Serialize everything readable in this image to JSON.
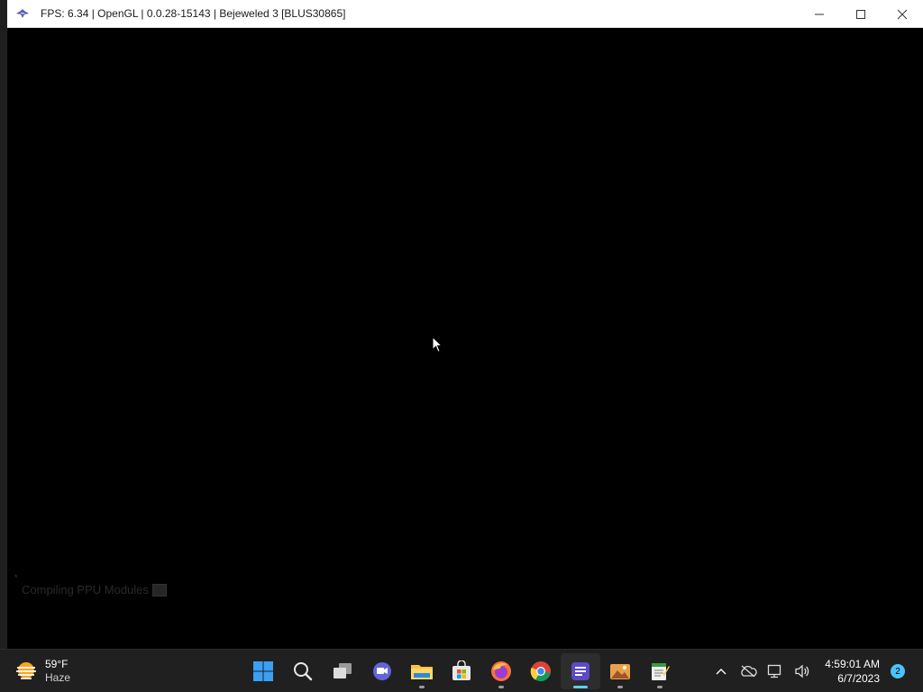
{
  "window": {
    "title": "FPS: 6.34 | OpenGL | 0.0.28-15143 | Bejeweled 3 [BLUS30865]",
    "app_icon": "rpcs3-icon",
    "controls": {
      "minimize_icon": "minimize-icon",
      "maximize_icon": "maximize-icon",
      "close_icon": "close-icon"
    }
  },
  "viewport": {
    "status_mark": "*",
    "compile_message": "Compiling PPU Modules"
  },
  "taskbar": {
    "weather": {
      "temp": "59°F",
      "condition": "Haze",
      "icon": "haze-weather-icon"
    },
    "apps": [
      {
        "name": "start-button",
        "icon": "windows-start-icon"
      },
      {
        "name": "search-button",
        "icon": "search-icon"
      },
      {
        "name": "task-view-button",
        "icon": "task-view-icon"
      },
      {
        "name": "teams-chat-button",
        "icon": "teams-chat-icon"
      },
      {
        "name": "file-explorer-button",
        "icon": "file-explorer-icon",
        "running": true
      },
      {
        "name": "microsoft-store-button",
        "icon": "store-icon"
      },
      {
        "name": "firefox-button",
        "icon": "firefox-icon",
        "running": true
      },
      {
        "name": "chrome-button",
        "icon": "chrome-icon"
      },
      {
        "name": "rpcs3-taskbar-button",
        "icon": "rpcs3-app-icon",
        "running": true,
        "active": true
      },
      {
        "name": "photos-button",
        "icon": "photos-icon",
        "running": true
      },
      {
        "name": "notepad-button",
        "icon": "notepad-icon",
        "running": true
      }
    ],
    "tray": {
      "time": "4:59:01 AM",
      "date": "6/7/2023",
      "notification_count": "2"
    }
  },
  "colors": {
    "taskbar_bg": "#202020",
    "accent": "#60cdff",
    "window_bg": "#000000"
  }
}
